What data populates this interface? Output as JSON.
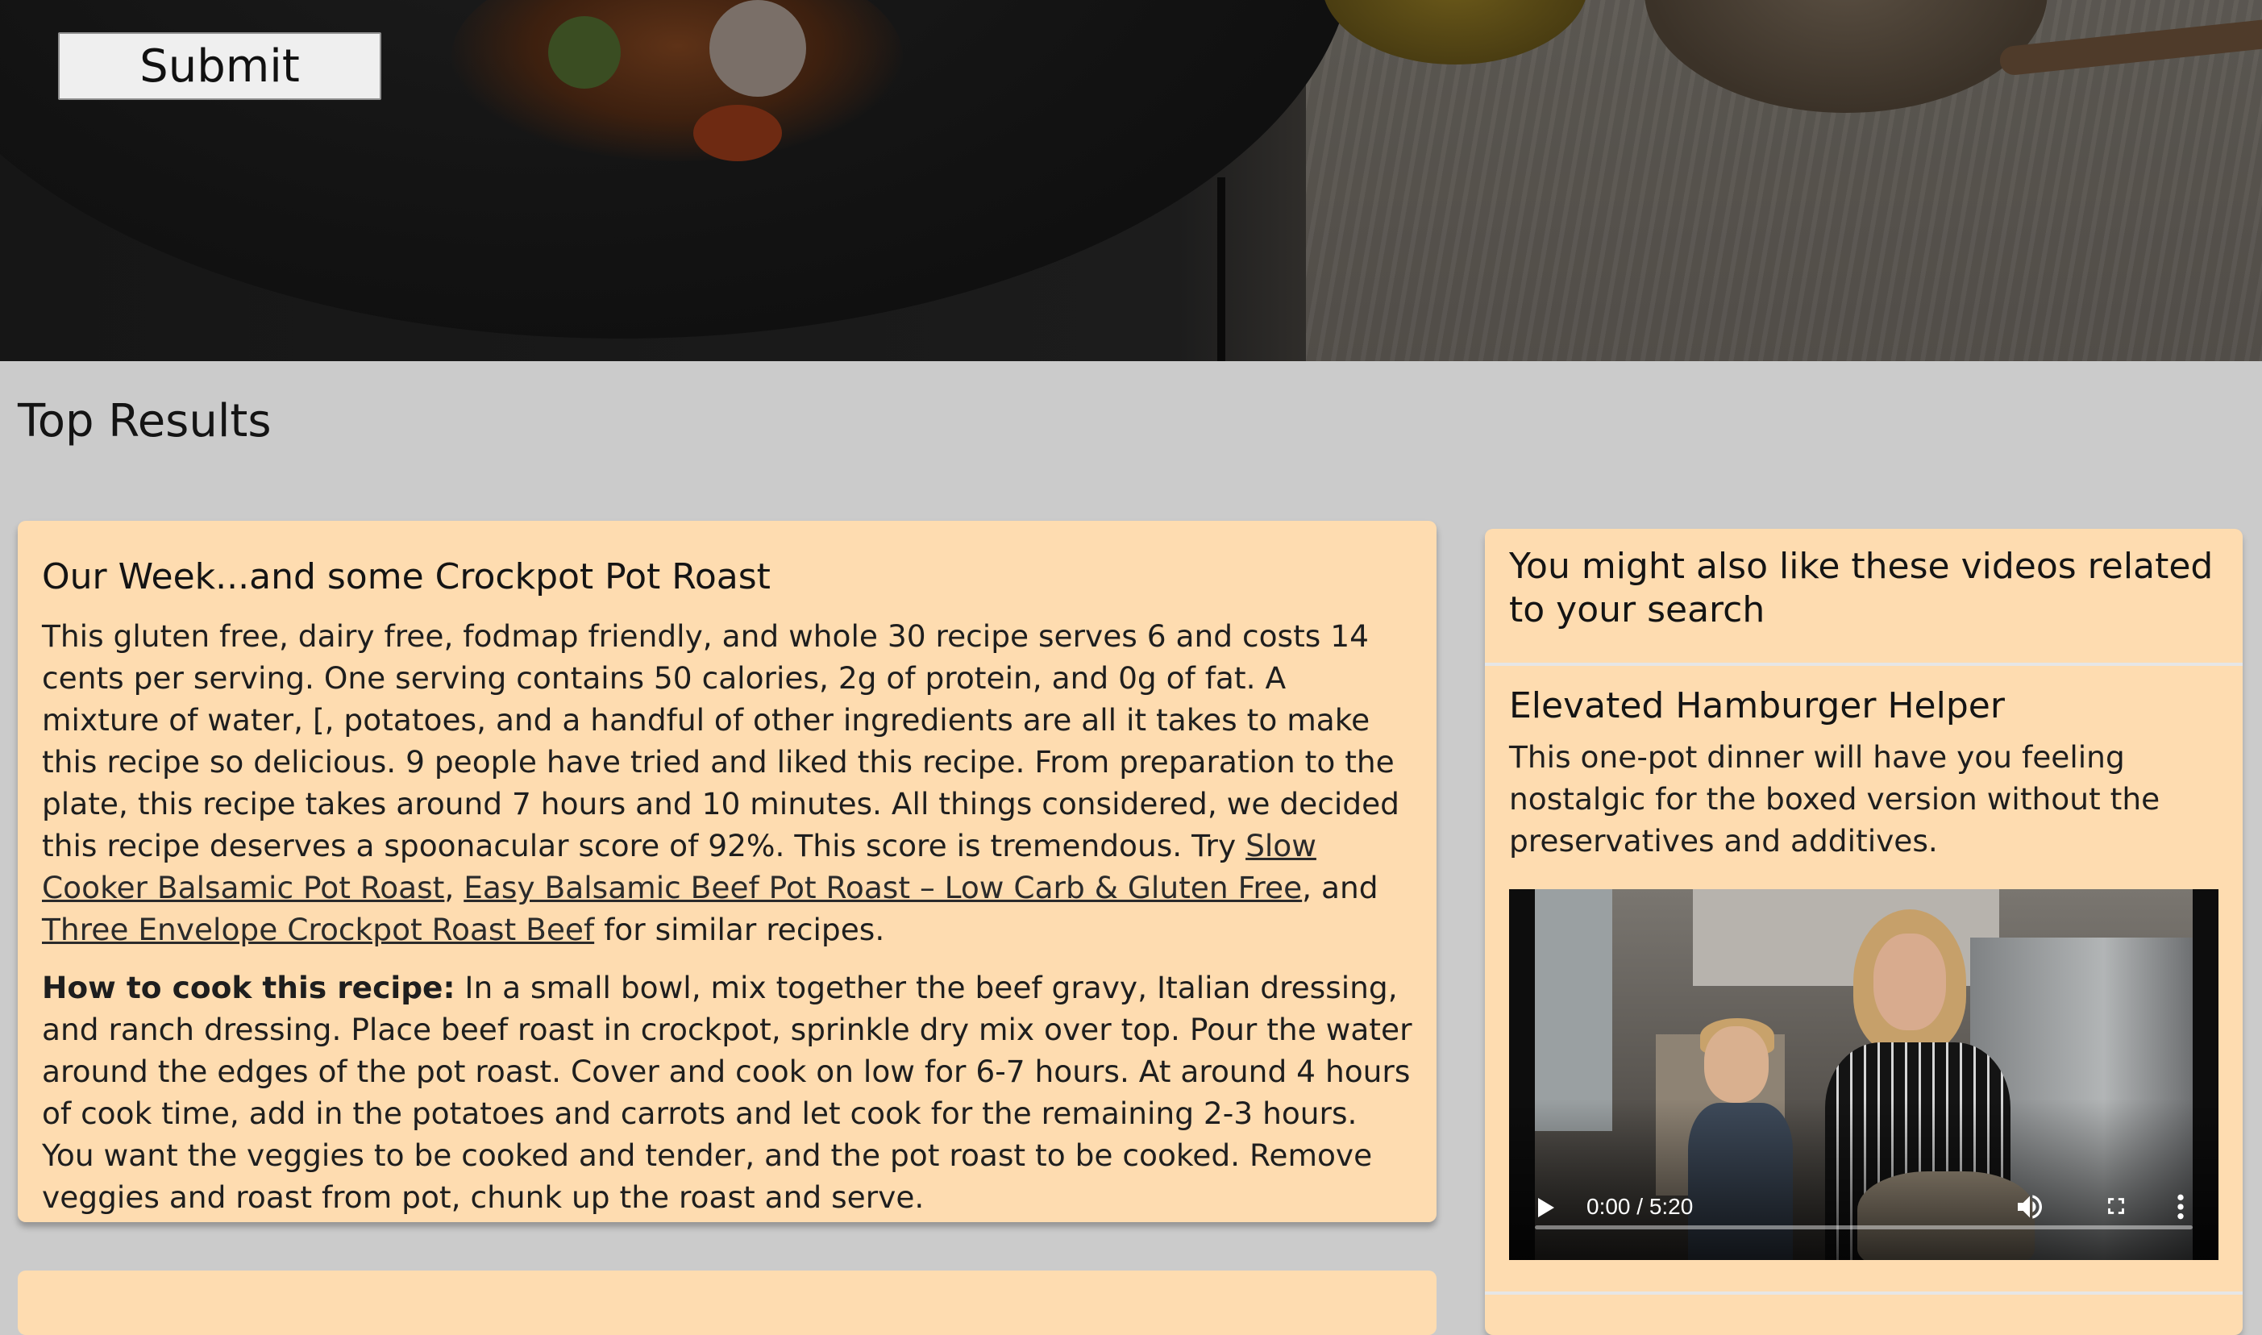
{
  "search": {
    "submit_label": "Submit"
  },
  "results": {
    "heading": "Top Results"
  },
  "recipe": {
    "title": "Our Week...and some Crockpot Pot Roast",
    "summary_intro": "This gluten free, dairy free, fodmap friendly, and whole 30 recipe serves 6 and costs 14 cents per serving. One serving contains 50 calories, 2g of protein, and 0g of fat. A mixture of water, [, potatoes, and a handful of other ingredients are all it takes to make this recipe so delicious. 9 people have tried and liked this recipe. From preparation to the plate, this recipe takes around 7 hours and 10 minutes. All things considered, we decided this recipe deserves a spoonacular score of 92%. This score is tremendous. Try ",
    "similar": [
      "Slow Cooker Balsamic Pot Roast",
      "Easy Balsamic Beef Pot Roast – Low Carb & Gluten Free",
      "Three Envelope Crockpot Roast Beef"
    ],
    "sep_comma": ", ",
    "sep_and": ", and ",
    "summary_outro": " for similar recipes.",
    "how_label": "How to cook this recipe:",
    "instructions": " In a small bowl, mix together the beef gravy, Italian dressing, and ranch dressing. Place beef roast in crockpot, sprinkle dry mix over top. Pour the water around the edges of the pot roast. Cover and cook on low for 6-7 hours. At around 4 hours of cook time, add in the potatoes and carrots and let cook for the remaining 2-3 hours. You want the veggies to be cooked and tender, and the pot roast to be cooked. Remove veggies and roast from pot, chunk up the roast and serve."
  },
  "videos": {
    "heading": "You might also like these videos related to your search",
    "items": [
      {
        "title": "Elevated Hamburger Helper",
        "description": "This one-pot dinner will have you feeling nostalgic for the boxed version without the preservatives and additives.",
        "time": "0:00 / 5:20",
        "progress": 0
      }
    ]
  },
  "icons": {
    "play": "play-icon",
    "volume": "volume-icon",
    "fullscreen": "fullscreen-icon",
    "more": "more-vertical-icon"
  },
  "colors": {
    "page_bg": "#cbcbcb",
    "card_bg": "#fedcb0",
    "text": "#1e1e1e"
  }
}
